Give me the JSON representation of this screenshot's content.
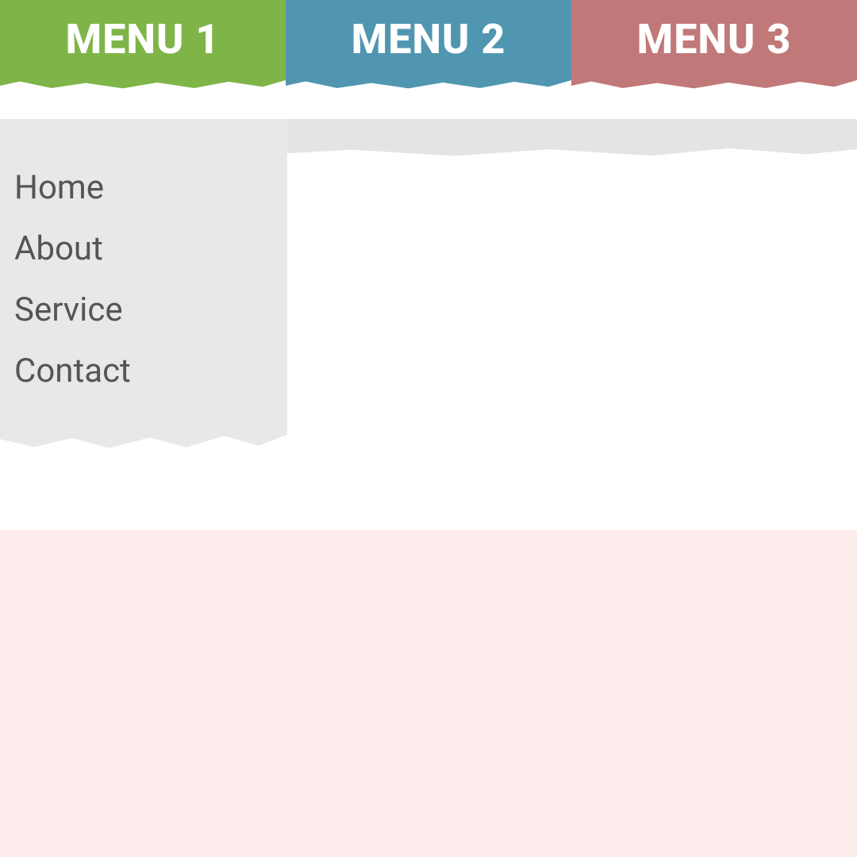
{
  "nav": {
    "tabs": [
      {
        "label": "MENU 1",
        "color": "#7fb548"
      },
      {
        "label": "MENU 2",
        "color": "#5196b0"
      },
      {
        "label": "MENU 3",
        "color": "#c17878"
      }
    ]
  },
  "dropdown": {
    "items": [
      {
        "label": "Home"
      },
      {
        "label": "About"
      },
      {
        "label": "Service"
      },
      {
        "label": "Contact"
      }
    ]
  },
  "colors": {
    "grey_bar": "#e4e4e4",
    "dropdown_bg": "#e8e8e8",
    "bottom_panel": "#fbeceb",
    "dropdown_text": "#555555",
    "tab_text": "#ffffff"
  }
}
